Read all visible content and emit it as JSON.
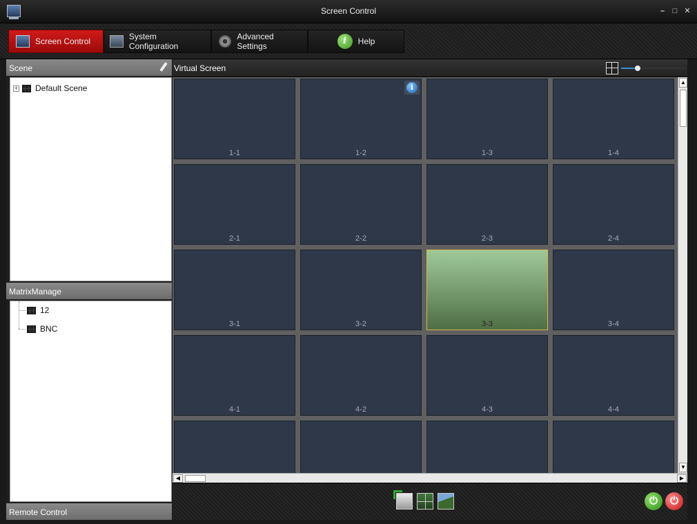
{
  "window": {
    "title": "Screen Control"
  },
  "tabs": [
    {
      "label": "Screen Control",
      "icon": "screen-control-icon",
      "active": true
    },
    {
      "label": "System Configuration",
      "icon": "system-configuration-icon"
    },
    {
      "label": "Advanced Settings",
      "icon": "gear-icon"
    },
    {
      "label": "Help",
      "icon": "help-icon"
    }
  ],
  "scene_panel": {
    "title": "Scene",
    "items": [
      {
        "label": "Default Scene"
      }
    ]
  },
  "matrix_panel": {
    "title": "MatrixManage",
    "items": [
      {
        "label": "12"
      },
      {
        "label": "BNC"
      }
    ]
  },
  "remote_panel": {
    "title": "Remote Control"
  },
  "virtual_screen": {
    "title": "Virtual Screen",
    "zoom_level_fraction": 0.25,
    "tiles": [
      [
        "1-1",
        "1-2",
        "1-3",
        "1-4"
      ],
      [
        "2-1",
        "2-2",
        "2-3",
        "2-4"
      ],
      [
        "3-1",
        "3-2",
        "3-3",
        "3-4"
      ],
      [
        "4-1",
        "4-2",
        "4-3",
        "4-4"
      ],
      [
        "",
        "",
        "",
        ""
      ]
    ],
    "selected_tile": "3-3",
    "info_tile": "1-2"
  },
  "toolbar": {
    "icons": [
      "dvi-input-icon",
      "split-screen-icon",
      "wall-image-icon"
    ],
    "power_on": "power-on-icon",
    "power_off": "power-off-icon"
  },
  "colors": {
    "accent_red": "#c01212",
    "tile_bg": "#2e3848",
    "selected_tile": "#8fbf88",
    "selected_border": "#d9b84a"
  }
}
